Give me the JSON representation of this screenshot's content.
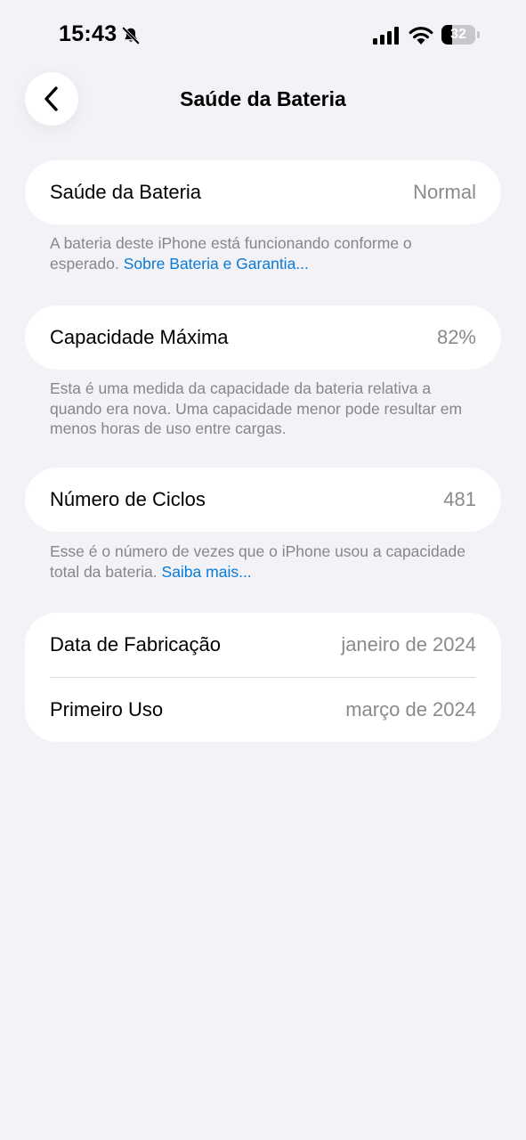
{
  "status_bar": {
    "time": "15:43",
    "battery_level": "32",
    "icons": [
      "bell-slash-icon",
      "cellular-signal-icon",
      "wifi-icon",
      "battery-icon"
    ]
  },
  "nav": {
    "title": "Saúde da Bateria",
    "back_icon": "chevron-left-icon"
  },
  "battery_health": {
    "label": "Saúde da Bateria",
    "value": "Normal",
    "footer_text": "A bateria deste iPhone está funcionando conforme o esperado.",
    "footer_link": "Sobre Bateria e Garantia..."
  },
  "max_capacity": {
    "label": "Capacidade Máxima",
    "value": "82%",
    "footer_text": "Esta é uma medida da capacidade da bateria relativa a quando era nova. Uma capacidade menor pode resultar em menos horas de uso entre cargas."
  },
  "cycle_count": {
    "label": "Número de Ciclos",
    "value": "481",
    "footer_text": "Esse é o número de vezes que o iPhone usou a capacidade total da bateria.",
    "footer_link": "Saiba mais..."
  },
  "dates": {
    "manufacture_label": "Data de Fabricação",
    "manufacture_value": "janeiro de 2024",
    "first_use_label": "Primeiro Uso",
    "first_use_value": "março de 2024"
  },
  "colors": {
    "background": "#f2f2f7",
    "card": "#ffffff",
    "secondary_text": "#8a8a8e",
    "link": "#0a7ad4"
  }
}
